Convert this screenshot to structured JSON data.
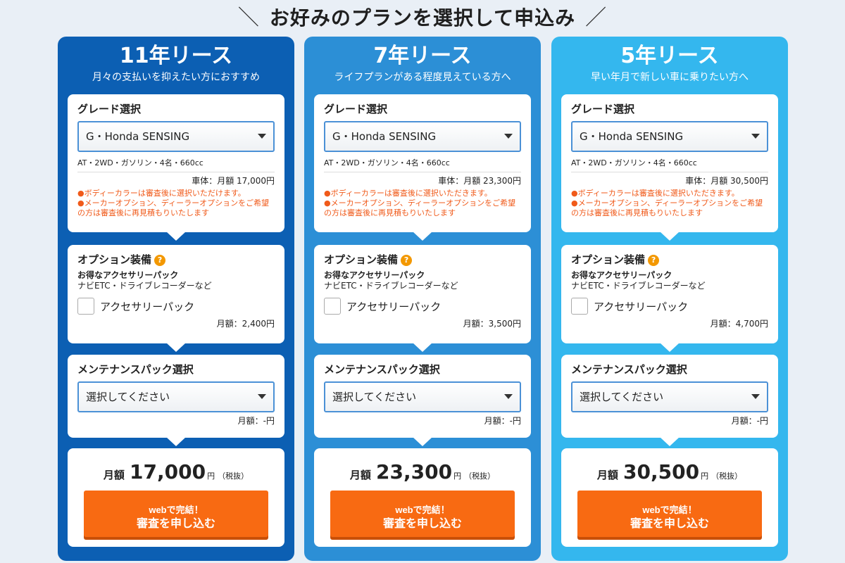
{
  "heading": {
    "slash_left": "＼",
    "text": "お好みのプランを選択して申込み",
    "slash_right": "／"
  },
  "labels": {
    "grade_title": "グレード選択",
    "options_title": "オプション装備",
    "help_icon": "?",
    "pack_name": "お得なアクセサリーパック",
    "pack_desc": "ナビETC・ドライブレコーダーなど",
    "pack_checkbox": "アクセサリーパック",
    "maint_title": "メンテナンスパック選択",
    "maint_placeholder": "選択してください",
    "maint_price": "月額：-円",
    "total_label": "月額",
    "total_unit": "円",
    "total_tax": "（税抜）",
    "apply_line1": "webで完結！",
    "apply_line2": "審査を申し込む",
    "note1": "●ボディーカラーは審査後に選択いただけます。",
    "note1_alt": "●ボディーカラーは審査後に選択いただきます。",
    "note2": "●メーカーオプション、ディーラーオプションをご希望の方は審査後に再見積もりいたします"
  },
  "plans": [
    {
      "title": "11年リース",
      "subtitle": "月々の支払いを抑えたい方におすすめ",
      "grade": "G・Honda SENSING",
      "spec": "AT・2WD・ガソリン・4名・660cc",
      "body_price": "車体：月額 17,000円",
      "note1": "●ボディーカラーは審査後に選択いただけます。",
      "pack_price": "月額：2,400円",
      "total": "17,000",
      "color": "#0c5fb3"
    },
    {
      "title": "7年リース",
      "subtitle": "ライフプランがある程度見えている方へ",
      "grade": "G・Honda SENSING",
      "spec": "AT・2WD・ガソリン・4名・660cc",
      "body_price": "車体：月額 23,300円",
      "note1": "●ボディーカラーは審査後に選択いただきます。",
      "pack_price": "月額：3,500円",
      "total": "23,300",
      "color": "#2c8fd6"
    },
    {
      "title": "5年リース",
      "subtitle": "早い年月で新しい車に乗りたい方へ",
      "grade": "G・Honda SENSING",
      "spec": "AT・2WD・ガソリン・4名・660cc",
      "body_price": "車体：月額 30,500円",
      "note1": "●ボディーカラーは審査後に選択いただきます。",
      "pack_price": "月額：4,700円",
      "total": "30,500",
      "color": "#34b7ee"
    }
  ],
  "colors": {
    "button": "#f86a12",
    "note": "#f05a1a",
    "help": "#f39800",
    "select_border": "#4b91d6"
  }
}
